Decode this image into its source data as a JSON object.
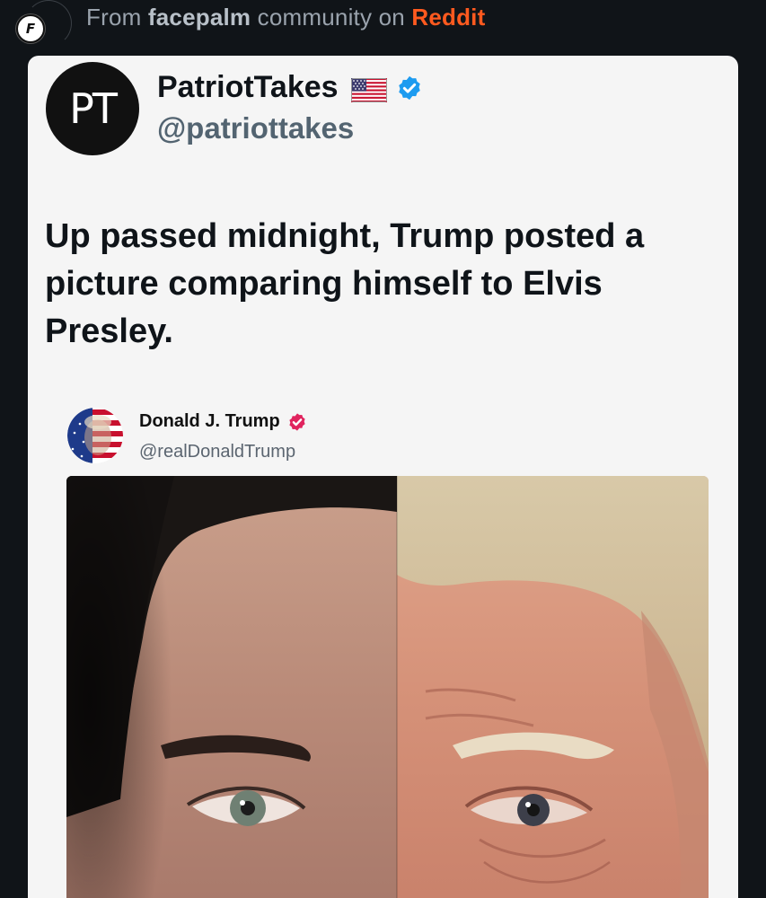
{
  "source": {
    "prefix": "From",
    "community": "facepalm",
    "middle": "community on",
    "platform": "Reddit",
    "community_logo_letter": "F"
  },
  "tweet": {
    "avatar_text": "PT",
    "display_name": "PatriotTakes",
    "handle": "@patriottakes",
    "text": "Up passed midnight, Trump posted a\npicture comparing himself to Elvis\nPresley.",
    "flag_icon": "us-flag-icon",
    "verified_icon": "verified-badge-icon"
  },
  "embedded_post": {
    "display_name": "Donald J. Trump",
    "handle": "@realDonaldTrump",
    "verified_icon": "verified-badge-icon",
    "image": "split-face-photo"
  },
  "colors": {
    "background": "#101418",
    "card": "#f5f5f5",
    "reddit_orange": "#ff5a1f",
    "verified_blue": "#1d9bf0",
    "verified_pink": "#e0245e"
  }
}
